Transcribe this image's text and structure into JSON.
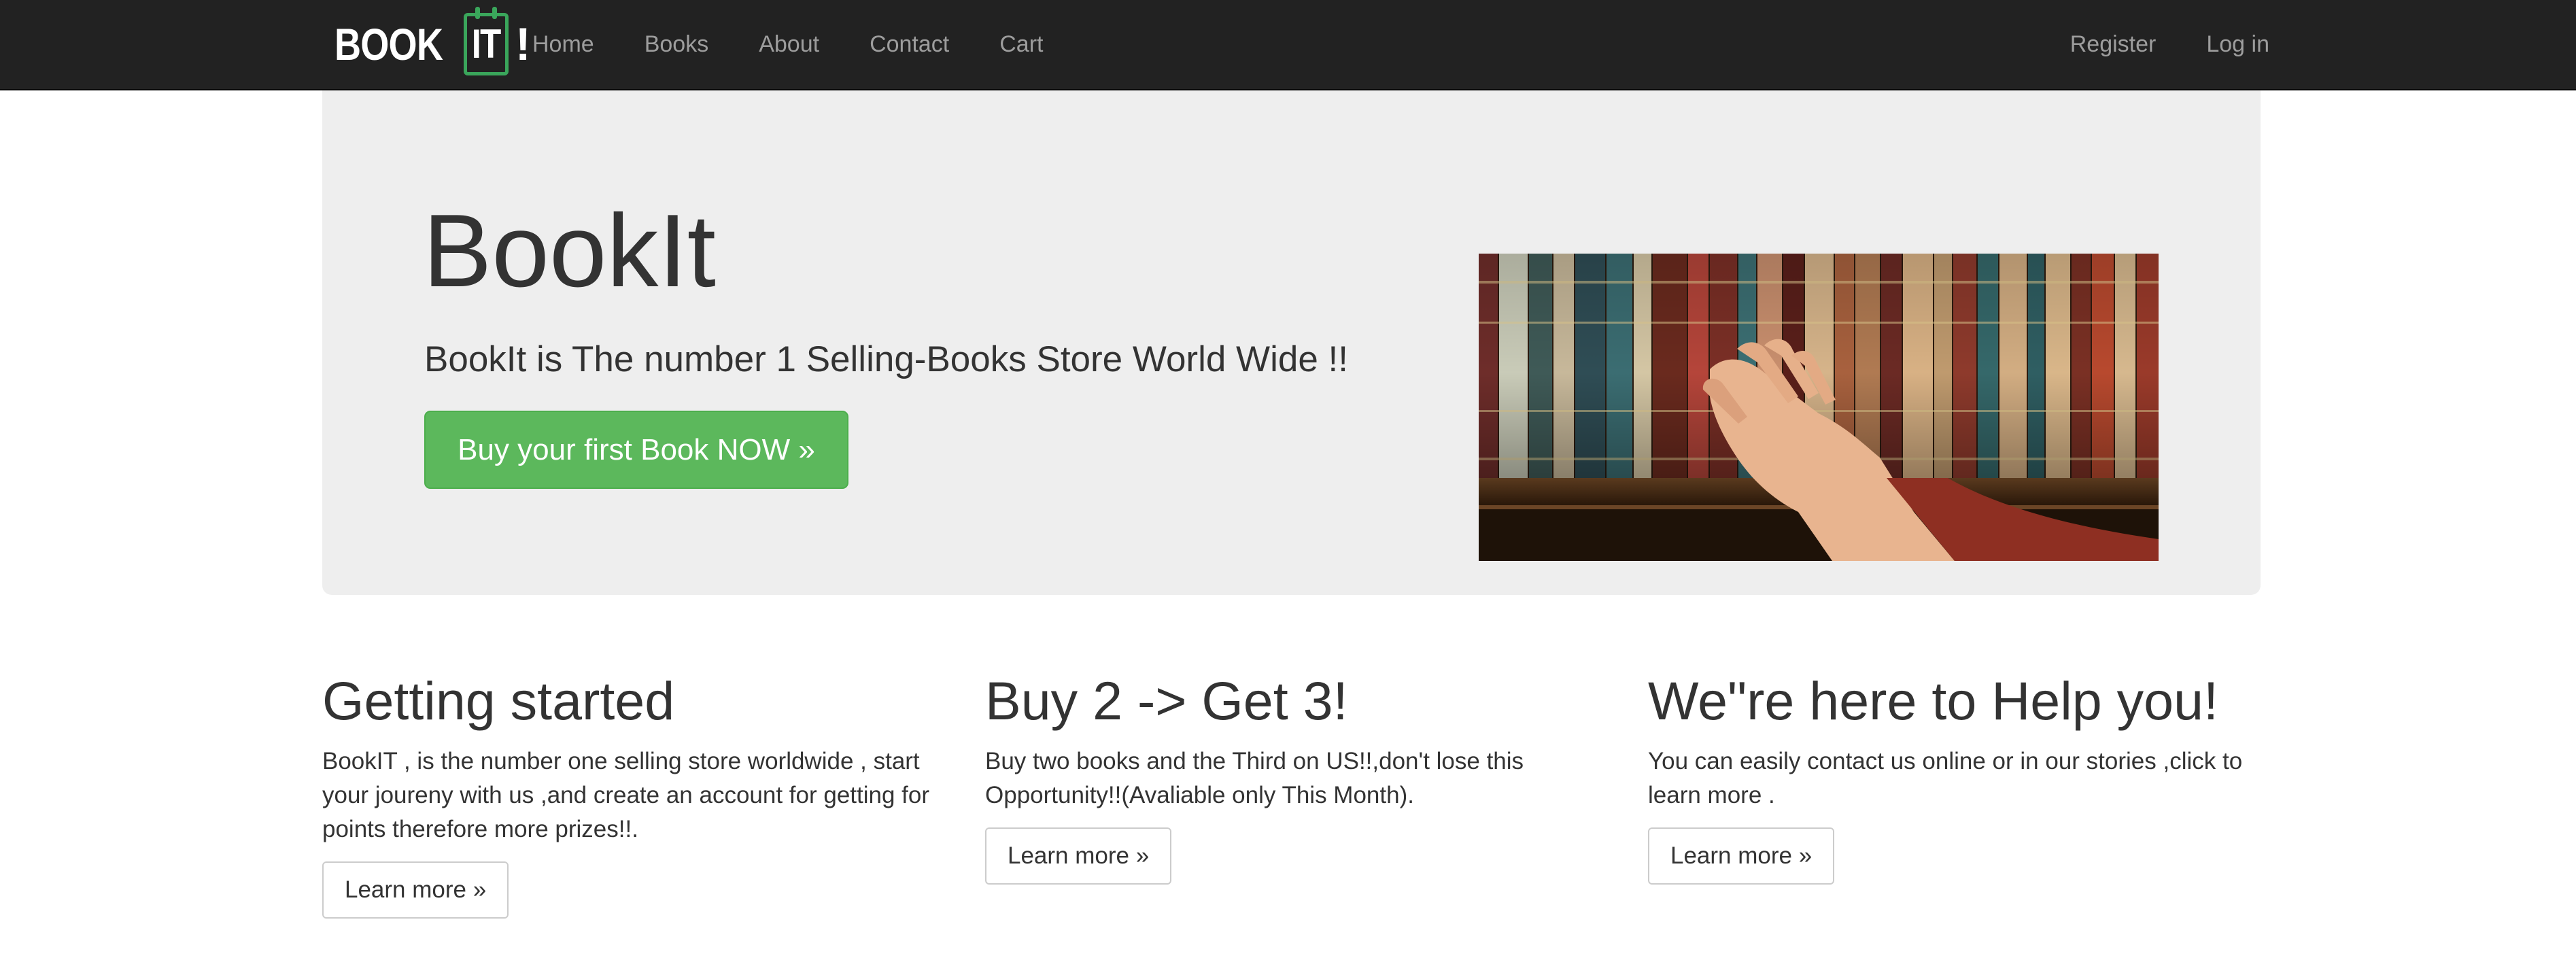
{
  "navbar": {
    "brand": {
      "word": "BOOK",
      "it": "IT",
      "bang": "!"
    },
    "left_links": [
      "Home",
      "Books",
      "About",
      "Contact",
      "Cart"
    ],
    "right_links": [
      "Register",
      "Log in"
    ]
  },
  "hero": {
    "title": "BookIt",
    "subtitle": "BookIt is The number 1 Selling-Books Store World Wide !!",
    "cta_label": "Buy your first Book NOW »",
    "image_icon": "bookshelf-photo"
  },
  "features": [
    {
      "title": "Getting started",
      "text": "BookIT , is the number one selling store worldwide , start your joureny with us ,and create an account for getting for points therefore more prizes!!.",
      "button": "Learn more »"
    },
    {
      "title": "Buy 2 -> Get 3!",
      "text": "Buy two books and the Third on US!!,don't lose this Opportunity!!(Avaliable only This Month).",
      "button": "Learn more »"
    },
    {
      "title": "We\"re here to Help you!",
      "text": "You can easily contact us online or in our stories ,click to learn more .",
      "button": "Learn more »"
    }
  ],
  "colors": {
    "navbar_bg": "#222222",
    "nav_link": "#9d9d9d",
    "jumbotron_bg": "#eeeeee",
    "success": "#5cb85c",
    "brand_green": "#3aa65b"
  }
}
